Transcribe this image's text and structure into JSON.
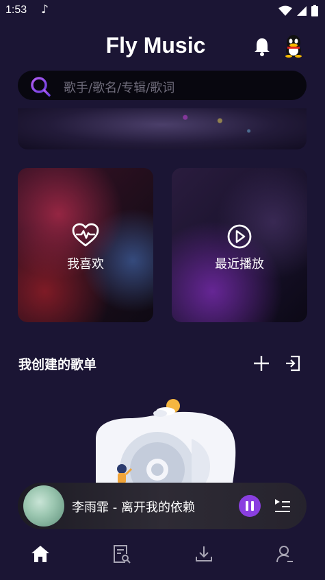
{
  "status_bar": {
    "time": "1:53"
  },
  "header": {
    "title": "Fly Music"
  },
  "search": {
    "placeholder": "歌手/歌名/专辑/歌词"
  },
  "quick_cards": [
    {
      "label": "我喜欢",
      "icon": "heart-pulse-icon"
    },
    {
      "label": "最近播放",
      "icon": "play-circle-icon"
    }
  ],
  "playlists": {
    "title": "我创建的歌单"
  },
  "player": {
    "song": "李雨霏 - 离开我的依赖"
  },
  "tabs": [
    {
      "icon": "home-icon",
      "active": true
    },
    {
      "icon": "document-search-icon",
      "active": false
    },
    {
      "icon": "download-icon",
      "active": false
    },
    {
      "icon": "user-icon",
      "active": false
    }
  ],
  "colors": {
    "accent": "#8a3fe0",
    "background": "#1b1534"
  }
}
